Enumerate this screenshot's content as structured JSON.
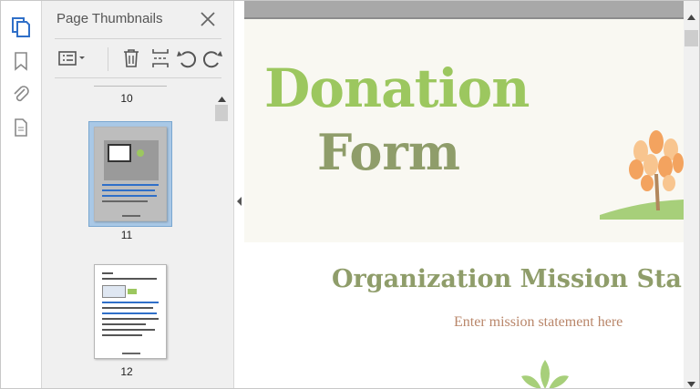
{
  "rail": {
    "icons": [
      "page-thumbnails-icon",
      "bookmark-icon",
      "attachment-icon",
      "document-properties-icon"
    ]
  },
  "panel": {
    "title": "Page Thumbnails",
    "toolbar": [
      "options-menu-icon",
      "delete-icon",
      "insert-pages-icon",
      "rotate-left-icon",
      "rotate-right-icon"
    ],
    "pages": [
      {
        "number": "10",
        "selected": false
      },
      {
        "number": "11",
        "selected": true
      },
      {
        "number": "12",
        "selected": false
      }
    ]
  },
  "document": {
    "title_line1": "Donation",
    "title_line2": "Form",
    "mission_heading": "Organization Mission Sta",
    "mission_text": "Enter mission statement here"
  },
  "colors": {
    "accent_icon": "#2f6fc8",
    "title_green": "#9cc75f",
    "form_green": "#8f9d6a",
    "mission_text": "#b9866a",
    "tree_orange": "#f3a35f"
  }
}
